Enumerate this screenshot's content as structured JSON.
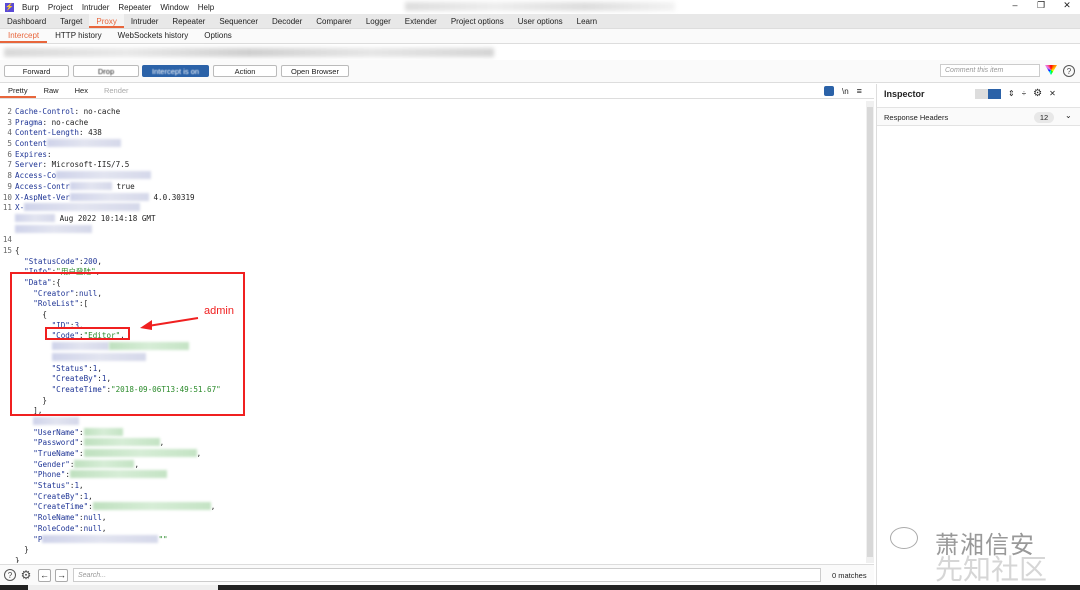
{
  "app": {
    "menu": [
      "Burp",
      "Project",
      "Intruder",
      "Repeater",
      "Window",
      "Help"
    ],
    "title_initial": "P"
  },
  "window_controls": {
    "minimize": "–",
    "restore": "❐",
    "close": "✕"
  },
  "main_tabs": [
    {
      "label": "Dashboard"
    },
    {
      "label": "Target"
    },
    {
      "label": "Proxy",
      "active": true
    },
    {
      "label": "Intruder"
    },
    {
      "label": "Repeater"
    },
    {
      "label": "Sequencer"
    },
    {
      "label": "Decoder"
    },
    {
      "label": "Comparer"
    },
    {
      "label": "Logger"
    },
    {
      "label": "Extender"
    },
    {
      "label": "Project options"
    },
    {
      "label": "User options"
    },
    {
      "label": "Learn"
    }
  ],
  "sub_tabs": [
    {
      "label": "Intercept",
      "active": true
    },
    {
      "label": "HTTP history"
    },
    {
      "label": "WebSockets history"
    },
    {
      "label": "Options"
    }
  ],
  "toolbar": {
    "forward": "Forward",
    "drop": "Drop",
    "intercept": "Intercept is on",
    "action": "Action",
    "open_browser": "Open Browser",
    "comment_placeholder": "Comment this item",
    "help": "?"
  },
  "editor_tabs": [
    {
      "label": "Pretty",
      "active": true
    },
    {
      "label": "Raw"
    },
    {
      "label": "Hex"
    },
    {
      "label": "Render",
      "disabled": true
    }
  ],
  "editor_icons": {
    "wrap": "wrap-icon",
    "newline": "\\n",
    "menu": "≡"
  },
  "code_lines": [
    {
      "num": "2",
      "segs": [
        [
          "k",
          "Cache-Control"
        ],
        [
          "p",
          ": no-cache"
        ]
      ]
    },
    {
      "num": "3",
      "segs": [
        [
          "k",
          "Pragma"
        ],
        [
          "p",
          ": no-cache"
        ]
      ]
    },
    {
      "num": "4",
      "segs": [
        [
          "k",
          "Content-Length"
        ],
        [
          "p",
          ": 438"
        ]
      ]
    },
    {
      "num": "5",
      "segs": [
        [
          "k",
          "Content"
        ],
        [
          "r",
          ""
        ]
      ]
    },
    {
      "num": "6",
      "segs": [
        [
          "k",
          "Expires"
        ],
        [
          "p",
          ": "
        ]
      ]
    },
    {
      "num": "7",
      "segs": [
        [
          "k",
          "Server"
        ],
        [
          "p",
          ": Microsoft-IIS/7.5"
        ]
      ]
    },
    {
      "num": "8",
      "segs": [
        [
          "k",
          "Access-Co"
        ],
        [
          "r",
          ""
        ]
      ]
    },
    {
      "num": "9",
      "segs": [
        [
          "k",
          "Access-Contr"
        ],
        [
          "r",
          ""
        ],
        [
          "p",
          " true"
        ]
      ]
    },
    {
      "num": "10",
      "segs": [
        [
          "k",
          "X-AspNet-Ver"
        ],
        [
          "r",
          ""
        ],
        [
          "p",
          " 4.0.30319"
        ]
      ]
    },
    {
      "num": "11",
      "segs": [
        [
          "k",
          "X-"
        ],
        [
          "r",
          ""
        ]
      ]
    },
    {
      "num": "",
      "segs": [
        [
          "r",
          ""
        ],
        [
          "p",
          " Aug 2022 10:14:18 GMT"
        ]
      ]
    },
    {
      "num": "",
      "segs": [
        [
          "r",
          ""
        ]
      ]
    },
    {
      "num": "14",
      "segs": []
    },
    {
      "num": "15",
      "segs": [
        [
          "p",
          "{"
        ]
      ]
    },
    {
      "num": "",
      "segs": [
        [
          "p",
          "  "
        ],
        [
          "k",
          "\"StatusCode\""
        ],
        [
          "p",
          ":"
        ],
        [
          "n",
          "200"
        ],
        [
          "p",
          ","
        ]
      ]
    },
    {
      "num": "",
      "segs": [
        [
          "p",
          "  "
        ],
        [
          "k",
          "\"Info\""
        ],
        [
          "p",
          ":"
        ],
        [
          "s",
          "\"用户登陆\""
        ],
        [
          "p",
          ","
        ]
      ]
    },
    {
      "num": "",
      "segs": [
        [
          "p",
          "  "
        ],
        [
          "k",
          "\"Data\""
        ],
        [
          "p",
          ":{"
        ]
      ]
    },
    {
      "num": "",
      "segs": [
        [
          "p",
          "    "
        ],
        [
          "k",
          "\"Creator\""
        ],
        [
          "p",
          ":"
        ],
        [
          "n",
          "null"
        ],
        [
          "p",
          ","
        ]
      ]
    },
    {
      "num": "",
      "segs": [
        [
          "p",
          "    "
        ],
        [
          "k",
          "\"RoleList\""
        ],
        [
          "p",
          ":["
        ]
      ]
    },
    {
      "num": "",
      "segs": [
        [
          "p",
          "      {"
        ]
      ]
    },
    {
      "num": "",
      "segs": [
        [
          "p",
          "        "
        ],
        [
          "k",
          "\"ID\""
        ],
        [
          "p",
          ":"
        ],
        [
          "n",
          "3"
        ],
        [
          "p",
          ","
        ]
      ]
    },
    {
      "num": "",
      "segs": [
        [
          "p",
          "        "
        ],
        [
          "k",
          "\"Code\""
        ],
        [
          "p",
          ":"
        ],
        [
          "s",
          "\"Editor\""
        ],
        [
          "p",
          ","
        ]
      ]
    },
    {
      "num": "",
      "segs": [
        [
          "p",
          "        "
        ],
        [
          "r",
          ""
        ],
        [
          "g",
          ""
        ]
      ]
    },
    {
      "num": "",
      "segs": [
        [
          "p",
          "        "
        ],
        [
          "r",
          ""
        ]
      ]
    },
    {
      "num": "",
      "segs": [
        [
          "p",
          "        "
        ],
        [
          "k",
          "\"Status\""
        ],
        [
          "p",
          ":"
        ],
        [
          "n",
          "1"
        ],
        [
          "p",
          ","
        ]
      ]
    },
    {
      "num": "",
      "segs": [
        [
          "p",
          "        "
        ],
        [
          "k",
          "\"CreateBy\""
        ],
        [
          "p",
          ":"
        ],
        [
          "n",
          "1"
        ],
        [
          "p",
          ","
        ]
      ]
    },
    {
      "num": "",
      "segs": [
        [
          "p",
          "        "
        ],
        [
          "k",
          "\"CreateTime\""
        ],
        [
          "p",
          ":"
        ],
        [
          "s",
          "\"2018-09-06T13:49:51.67\""
        ]
      ]
    },
    {
      "num": "",
      "segs": [
        [
          "p",
          "      }"
        ]
      ]
    },
    {
      "num": "",
      "segs": [
        [
          "p",
          "    ],"
        ]
      ]
    },
    {
      "num": "",
      "segs": [
        [
          "p",
          "    "
        ],
        [
          "r",
          ""
        ]
      ]
    },
    {
      "num": "",
      "segs": [
        [
          "p",
          "    "
        ],
        [
          "k",
          "\"UserName\""
        ],
        [
          "p",
          ":"
        ],
        [
          "g",
          ""
        ]
      ]
    },
    {
      "num": "",
      "segs": [
        [
          "p",
          "    "
        ],
        [
          "k",
          "\"Password\""
        ],
        [
          "p",
          ":"
        ],
        [
          "g",
          ""
        ],
        [
          "p",
          ","
        ]
      ]
    },
    {
      "num": "",
      "segs": [
        [
          "p",
          "    "
        ],
        [
          "k",
          "\"TrueName\""
        ],
        [
          "p",
          ":"
        ],
        [
          "g",
          ""
        ],
        [
          "p",
          ","
        ]
      ]
    },
    {
      "num": "",
      "segs": [
        [
          "p",
          "    "
        ],
        [
          "k",
          "\"Gender\""
        ],
        [
          "p",
          ":"
        ],
        [
          "g",
          ""
        ],
        [
          "p",
          ","
        ]
      ]
    },
    {
      "num": "",
      "segs": [
        [
          "p",
          "    "
        ],
        [
          "k",
          "\"Phone\""
        ],
        [
          "p",
          ":"
        ],
        [
          "g",
          ""
        ]
      ]
    },
    {
      "num": "",
      "segs": [
        [
          "p",
          "    "
        ],
        [
          "k",
          "\"Status\""
        ],
        [
          "p",
          ":"
        ],
        [
          "n",
          "1"
        ],
        [
          "p",
          ","
        ]
      ]
    },
    {
      "num": "",
      "segs": [
        [
          "p",
          "    "
        ],
        [
          "k",
          "\"CreateBy\""
        ],
        [
          "p",
          ":"
        ],
        [
          "n",
          "1"
        ],
        [
          "p",
          ","
        ]
      ]
    },
    {
      "num": "",
      "segs": [
        [
          "p",
          "    "
        ],
        [
          "k",
          "\"CreateTime\""
        ],
        [
          "p",
          ":"
        ],
        [
          "g",
          ""
        ],
        [
          "p",
          ","
        ]
      ]
    },
    {
      "num": "",
      "segs": [
        [
          "p",
          "    "
        ],
        [
          "k",
          "\"RoleName\""
        ],
        [
          "p",
          ":"
        ],
        [
          "n",
          "null"
        ],
        [
          "p",
          ","
        ]
      ]
    },
    {
      "num": "",
      "segs": [
        [
          "p",
          "    "
        ],
        [
          "k",
          "\"RoleCode\""
        ],
        [
          "p",
          ":"
        ],
        [
          "n",
          "null"
        ],
        [
          "p",
          ","
        ]
      ]
    },
    {
      "num": "",
      "segs": [
        [
          "p",
          "    "
        ],
        [
          "k",
          "\"P"
        ],
        [
          "r",
          ""
        ],
        [
          "s",
          "\"\""
        ]
      ]
    },
    {
      "num": "",
      "segs": [
        [
          "p",
          "  }"
        ]
      ]
    },
    {
      "num": "",
      "segs": [
        [
          "p",
          "}"
        ]
      ]
    }
  ],
  "annotation": {
    "label": "admin",
    "color": "#f02020"
  },
  "search": {
    "placeholder": "Search...",
    "matches": "0 matches"
  },
  "inspector": {
    "title": "Inspector",
    "sections": [
      {
        "label": "Response Headers",
        "count": "12"
      }
    ]
  },
  "watermark": {
    "text": "萧湘信安",
    "sub": "先知社区"
  },
  "colors": {
    "accent": "#e8663c",
    "primary": "#2b62a8",
    "highlight": "#f02020"
  }
}
